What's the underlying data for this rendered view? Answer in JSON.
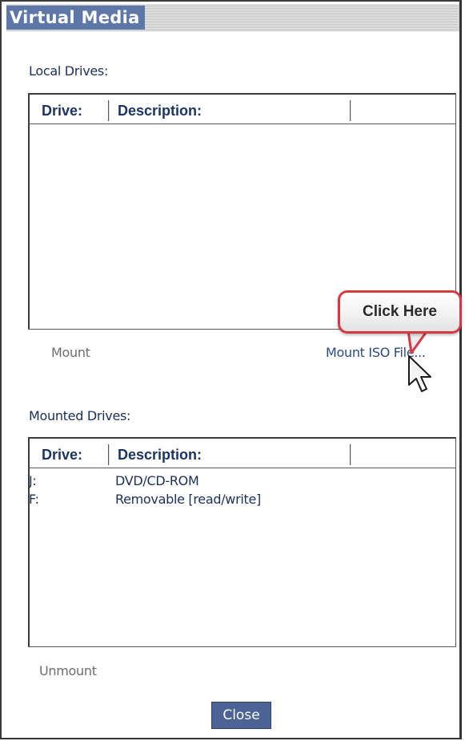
{
  "window": {
    "title": "Virtual Media"
  },
  "local_drives": {
    "label": "Local Drives:",
    "columns": [
      "Drive:",
      "Description:",
      ""
    ],
    "rows": []
  },
  "actions": {
    "mount_label": "Mount",
    "mount_iso_label": "Mount ISO File...",
    "unmount_label": "Unmount",
    "close_label": "Close"
  },
  "mounted_drives": {
    "label": "Mounted Drives:",
    "columns": [
      "Drive:",
      "Description:",
      ""
    ],
    "rows": [
      {
        "drive": "J:",
        "description": "DVD/CD-ROM"
      },
      {
        "drive": "F:",
        "description": "Removable [read/write]"
      }
    ]
  },
  "callout": {
    "text": "Click Here"
  },
  "icons": {
    "cursor": "pointer-cursor-icon"
  },
  "colors": {
    "title_bg": "#5d77a8",
    "close_button_bg": "#4c6396",
    "callout_border": "#d43a45",
    "text": "#1c2f57"
  }
}
